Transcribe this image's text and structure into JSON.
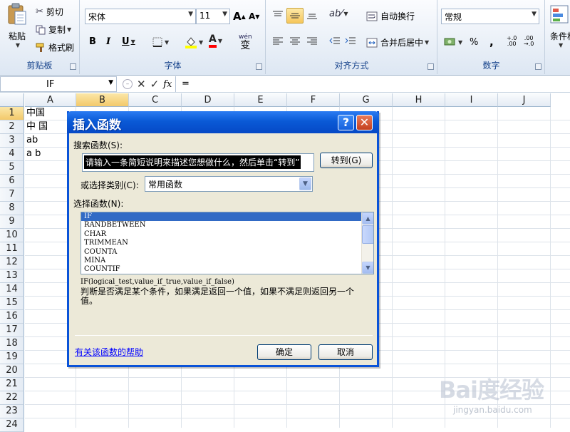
{
  "ribbon": {
    "clipboard": {
      "paste": "粘贴",
      "cut": "剪切",
      "copy": "复制",
      "format_painter": "格式刷",
      "group": "剪贴板"
    },
    "font": {
      "font_name": "宋体",
      "font_size": "11",
      "grow": "A",
      "shrink": "A",
      "bold": "B",
      "italic": "I",
      "underline": "U",
      "wen": "wén",
      "bian": "变",
      "group": "字体"
    },
    "align": {
      "wrap": "自动换行",
      "merge": "合并后居中",
      "group": "对齐方式"
    },
    "number": {
      "format": "常规",
      "percent": "%",
      "comma": ",",
      "inc": "+.0",
      "dec": ".00",
      "group": "数字"
    },
    "styles": {
      "conditional": "条件格式"
    }
  },
  "formula_bar": {
    "name_box": "IF",
    "fx": "fx",
    "formula": "="
  },
  "grid": {
    "columns": [
      "A",
      "B",
      "C",
      "D",
      "E",
      "F",
      "G",
      "H",
      "I",
      "J"
    ],
    "rows": [
      "1",
      "2",
      "3",
      "4",
      "5",
      "6",
      "7",
      "8",
      "9",
      "10",
      "11",
      "12",
      "13",
      "14",
      "15",
      "16",
      "17",
      "18",
      "19",
      "20",
      "21",
      "22",
      "23",
      "24"
    ],
    "cells": {
      "A1": "中国",
      "A2": "中 国",
      "A3": "ab",
      "A4": "a b"
    }
  },
  "dialog": {
    "title": "插入函数",
    "help_btn": "?",
    "close_btn": "✕",
    "search_label": "搜索函数(S):",
    "search_value": "请输入一条简短说明来描述您想做什么，然后单击“转到”",
    "go_button": "转到(G)",
    "category_label": "或选择类别(C):",
    "category_value": "常用函数",
    "select_label": "选择函数(N):",
    "functions": [
      "IF",
      "RANDBETWEEN",
      "CHAR",
      "TRIMMEAN",
      "COUNTA",
      "MINA",
      "COUNTIF"
    ],
    "syntax": "IF(logical_test,value_if_true,value_if_false)",
    "description": "判断是否满足某个条件，如果满足返回一个值，如果不满足则返回另一个值。",
    "help_link": "有关该函数的帮助",
    "ok": "确定",
    "cancel": "取消"
  },
  "watermark": {
    "logo": "Bai度经验",
    "url": "jingyan.baidu.com"
  }
}
